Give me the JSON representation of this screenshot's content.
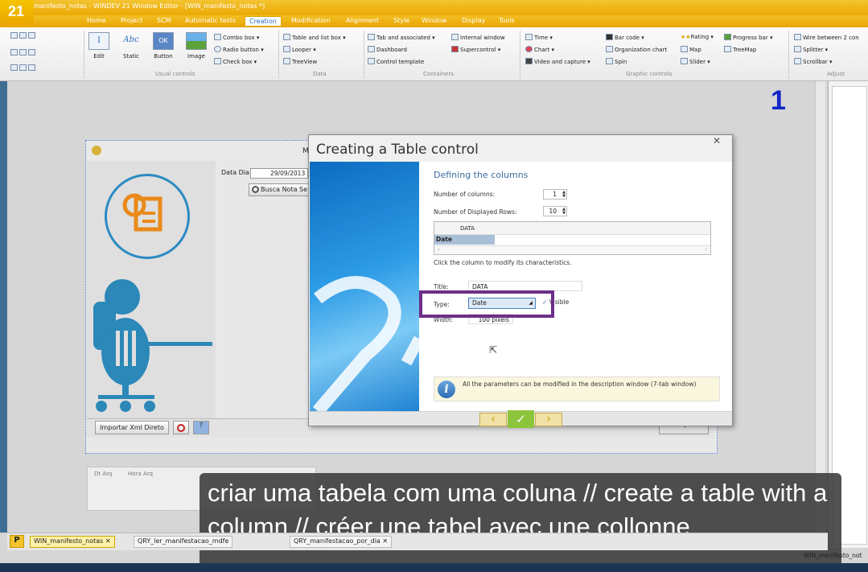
{
  "app": {
    "version": "21",
    "title": "manifesto_notas - WINDEV 21  Window Editor - [WIN_manifesto_notas *]"
  },
  "menu": [
    "Home",
    "Project",
    "SCM",
    "Automatic tests",
    "Creation",
    "Modification",
    "Alignment",
    "Style",
    "Window",
    "Display",
    "Tools"
  ],
  "active_menu": "Creation",
  "ribbon": {
    "big_buttons": [
      "Edit",
      "Static",
      "Button",
      "Image"
    ],
    "static_glyph": "Abc",
    "button_glyph": "OK",
    "groups": {
      "usual": "Usual controls",
      "data": "Data",
      "containers": "Containers",
      "graphic": "Graphic controls",
      "adjust": "Adjust"
    },
    "items": {
      "combo": "Combo box",
      "radio": "Radio button",
      "check": "Check box",
      "table": "Table and list box",
      "looper": "Looper",
      "treeview": "TreeView",
      "tab": "Tab and associated",
      "dashboard": "Dashboard",
      "template": "Control template",
      "internal": "Internal window",
      "supercontrol": "Supercontrol",
      "time": "Time",
      "chart": "Chart",
      "video": "Video and capture",
      "barcode": "Bar code",
      "orgchart": "Organization chart",
      "spin": "Spin",
      "rating": "Rating",
      "map": "Map",
      "slider": "Slider",
      "progress": "Progress bar",
      "treemap": "TreeMap",
      "wire": "Wire between 2 con",
      "splitter": "Splitter",
      "scrollbar": "Scrollbar"
    }
  },
  "workspace": {
    "number_label": "1"
  },
  "bg_window": {
    "title_fragment": "M",
    "data_label": "Data Dia",
    "data_value": "29/09/2013",
    "search_button": "Busca Nota Se",
    "import_button": "Importar Xml Direto",
    "table_columns": [
      "Dt Arq",
      "Hora Arq"
    ]
  },
  "dialog": {
    "title": "Creating a Table control",
    "heading": "Defining the columns",
    "num_columns_label": "Number of columns:",
    "num_columns_value": "1",
    "num_rows_label": "Number of Displayed Rows:",
    "num_rows_value": "10",
    "grid_header": "DATA",
    "grid_row": "Date",
    "hint": "Click the column to modify its characteristics.",
    "title_label": "Title:",
    "title_value": "DATA",
    "type_label": "Type:",
    "type_value": "Date",
    "visible_label": "Visible",
    "width_label": "Width:",
    "width_value": "100 pixels",
    "info": "All the parameters can be modified in the description window (7-tab window)"
  },
  "caption": "criar uma tabela com uma coluna  // create a table with a column // créer une tabel avec une collonne",
  "tabs": [
    "WIN_manifesto_notas",
    "QRY_ler_manifestacao_mdfe",
    "QRY_manifestacao_por_dia"
  ],
  "status_right": "WIN_manifesto_not"
}
